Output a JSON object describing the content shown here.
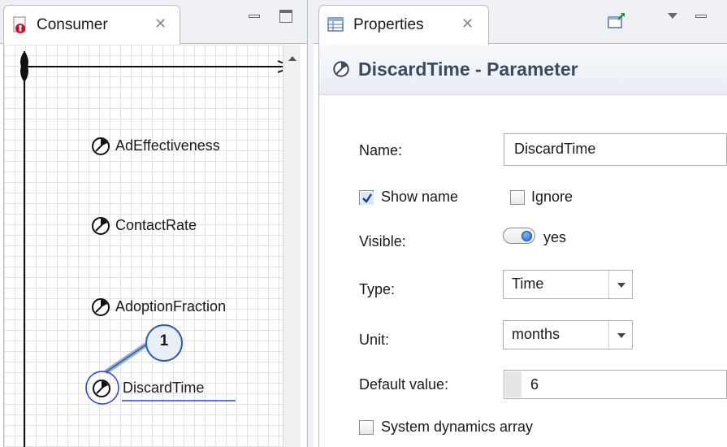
{
  "consumer_panel": {
    "tab_label": "Consumer",
    "tab_icon": "agent-icon",
    "close_glyph": "✕",
    "parameters": [
      {
        "label": "AdEffectiveness"
      },
      {
        "label": "ContactRate"
      },
      {
        "label": "AdoptionFraction"
      },
      {
        "label": "DiscardTime",
        "selected": true
      }
    ],
    "callout": "1"
  },
  "properties_panel": {
    "tab_label": "Properties",
    "close_glyph": "✕",
    "title": "DiscardTime - Parameter",
    "name_label": "Name:",
    "name_value": "DiscardTime",
    "show_name_label": "Show name",
    "show_name_checked": true,
    "ignore_label": "Ignore",
    "ignore_checked": false,
    "visible_label": "Visible:",
    "visible_value": "yes",
    "type_label": "Type:",
    "type_value": "Time",
    "unit_label": "Unit:",
    "unit_value": "months",
    "default_label": "Default value:",
    "default_value": "6",
    "sd_array_label": "System dynamics array",
    "sd_array_checked": false
  },
  "colors": {
    "accent": "#1c63c9",
    "title_text": "#3a4a63",
    "callout": "#2c5fa8",
    "selection": "#2a3ee0"
  }
}
